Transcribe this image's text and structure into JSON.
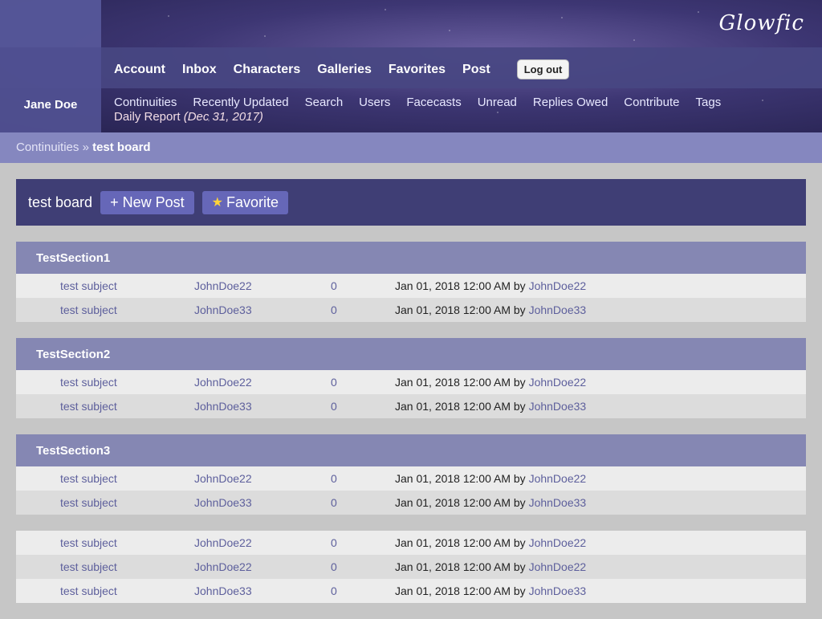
{
  "header": {
    "logo": "Glowfic",
    "nav": [
      "Account",
      "Inbox",
      "Characters",
      "Galleries",
      "Favorites",
      "Post"
    ],
    "logout_label": "Log out",
    "username": "Jane Doe",
    "subnav": [
      "Continuities",
      "Recently Updated",
      "Search",
      "Users",
      "Facecasts",
      "Unread",
      "Replies Owed",
      "Contribute",
      "Tags"
    ],
    "daily_report_label": "Daily Report",
    "daily_report_date": "(Dec 31, 2017)"
  },
  "breadcrumb": {
    "root": "Continuities",
    "separator": "»",
    "current": "test board"
  },
  "board": {
    "title": "test board",
    "new_post_label": "+ New Post",
    "favorite_label": "Favorite"
  },
  "sections": [
    {
      "title": "TestSection1",
      "rows": [
        {
          "subject": "test subject",
          "author": "JohnDoe22",
          "replies": "0",
          "updated": "Jan 01, 2018 12:00 AM",
          "by": "by",
          "last_author": "JohnDoe22"
        },
        {
          "subject": "test subject",
          "author": "JohnDoe33",
          "replies": "0",
          "updated": "Jan 01, 2018 12:00 AM",
          "by": "by",
          "last_author": "JohnDoe33"
        }
      ]
    },
    {
      "title": "TestSection2",
      "rows": [
        {
          "subject": "test subject",
          "author": "JohnDoe22",
          "replies": "0",
          "updated": "Jan 01, 2018 12:00 AM",
          "by": "by",
          "last_author": "JohnDoe22"
        },
        {
          "subject": "test subject",
          "author": "JohnDoe33",
          "replies": "0",
          "updated": "Jan 01, 2018 12:00 AM",
          "by": "by",
          "last_author": "JohnDoe33"
        }
      ]
    },
    {
      "title": "TestSection3",
      "rows": [
        {
          "subject": "test subject",
          "author": "JohnDoe22",
          "replies": "0",
          "updated": "Jan 01, 2018 12:00 AM",
          "by": "by",
          "last_author": "JohnDoe22"
        },
        {
          "subject": "test subject",
          "author": "JohnDoe33",
          "replies": "0",
          "updated": "Jan 01, 2018 12:00 AM",
          "by": "by",
          "last_author": "JohnDoe33"
        }
      ]
    },
    {
      "title": "",
      "rows": [
        {
          "subject": "test subject",
          "author": "JohnDoe22",
          "replies": "0",
          "updated": "Jan 01, 2018 12:00 AM",
          "by": "by",
          "last_author": "JohnDoe22"
        },
        {
          "subject": "test subject",
          "author": "JohnDoe22",
          "replies": "0",
          "updated": "Jan 01, 2018 12:00 AM",
          "by": "by",
          "last_author": "JohnDoe22"
        },
        {
          "subject": "test subject",
          "author": "JohnDoe33",
          "replies": "0",
          "updated": "Jan 01, 2018 12:00 AM",
          "by": "by",
          "last_author": "JohnDoe33"
        }
      ]
    }
  ],
  "colors": {
    "header_dark": "#3f3e75",
    "breadcrumb_bg": "#8587bf",
    "section_head": "#8587b3",
    "link": "#5d5f9c"
  }
}
